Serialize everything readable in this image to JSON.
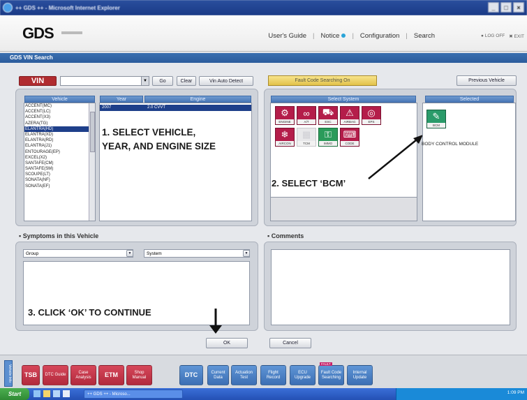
{
  "window": {
    "title": "++ GDS ++ - Microsoft Internet Explorer",
    "controls": [
      "_",
      "□",
      "×"
    ]
  },
  "header": {
    "logo": "GDS",
    "nav": [
      "User's Guide",
      "Notice",
      "Configuration",
      "Search"
    ],
    "logoff": "LOG OFF",
    "exit": "EXIT"
  },
  "page": {
    "title": "GDS VIN Search"
  },
  "toolbar": {
    "vin_label": "VIN",
    "go": "Go",
    "clear": "Clear",
    "vin_auto": "Vin Auto Detect",
    "fault": "Fault Code Searching On",
    "previous": "Previous Vehicle"
  },
  "vehicle_panel": {
    "col_vehicle": "Vehicle",
    "col_year": "Year",
    "col_engine": "Engine",
    "selected_year": "2007",
    "selected_engine": "2.0 CVVT",
    "vehicles": [
      "ACCENT(MC)",
      "ACCENT(LC)",
      "ACCENT(X3)",
      "AZERA(TG)",
      "ELANTRA(HD)",
      "ELANTRA(XD)",
      "ELANTRA(RD)",
      "ELANTRA(J1)",
      "ENTOURAGE(EP)",
      "EXCEL(X2)",
      "SANTAFE(CM)",
      "SANTAFE(SM)",
      "SCOUPE(LT)",
      "SONATA(NF)",
      "SONATA(EF)"
    ],
    "selected_index": 4
  },
  "system_panel": {
    "title": "Select System",
    "icons": [
      {
        "label": "ENGINE",
        "on": true
      },
      {
        "label": "A/T",
        "on": true
      },
      {
        "label": "ESC",
        "on": true
      },
      {
        "label": "AIRBAG",
        "on": true
      },
      {
        "label": "EPS",
        "on": true
      },
      {
        "label": "AIRCON",
        "on": true
      },
      {
        "label": "TCM",
        "on": false
      },
      {
        "label": "IMMO",
        "on": true
      },
      {
        "label": "CODE",
        "on": true
      }
    ]
  },
  "selected_panel": {
    "title": "Selected",
    "item_label": "BCM",
    "item_desc": "BODY CONTROL MODULE"
  },
  "symptoms": {
    "title": "Symptoms in this Vehicle",
    "group": "Group",
    "system": "System"
  },
  "comments": {
    "title": "Comments"
  },
  "actions": {
    "ok": "OK",
    "cancel": "Cancel"
  },
  "annotations": {
    "step1_line1": "1.  SELECT VEHICLE,",
    "step1_line2": "YEAR, AND ENGINE SIZE",
    "step2": "2.  SELECT ‘BCM’",
    "step3": "3.  CLICK ‘OK’ TO CONTINUE"
  },
  "bottom_toolbar": {
    "side": "Vehicle Info",
    "buttons": [
      {
        "label": "TSB"
      },
      {
        "label": "DTC Guide"
      },
      {
        "label": "Case Analysis"
      },
      {
        "label": "ETM"
      },
      {
        "label": "Shop Manual"
      },
      {
        "label": "DTC"
      },
      {
        "label": "Current Data"
      },
      {
        "label": "Actuation Test"
      },
      {
        "label": "Flight Record"
      },
      {
        "label": "ECU Upgrade"
      },
      {
        "label": "Fault Code Searching"
      },
      {
        "label": "Internal Update"
      }
    ],
    "badge": "FAULT"
  },
  "taskbar": {
    "start": "Start",
    "task1": "++ GDS ++ - Microso...",
    "time": "1:09 PM"
  },
  "colors": {
    "accent_red": "#b02c30",
    "panel_blue": "#4a78b6",
    "fault_yellow": "#e2c24a"
  }
}
